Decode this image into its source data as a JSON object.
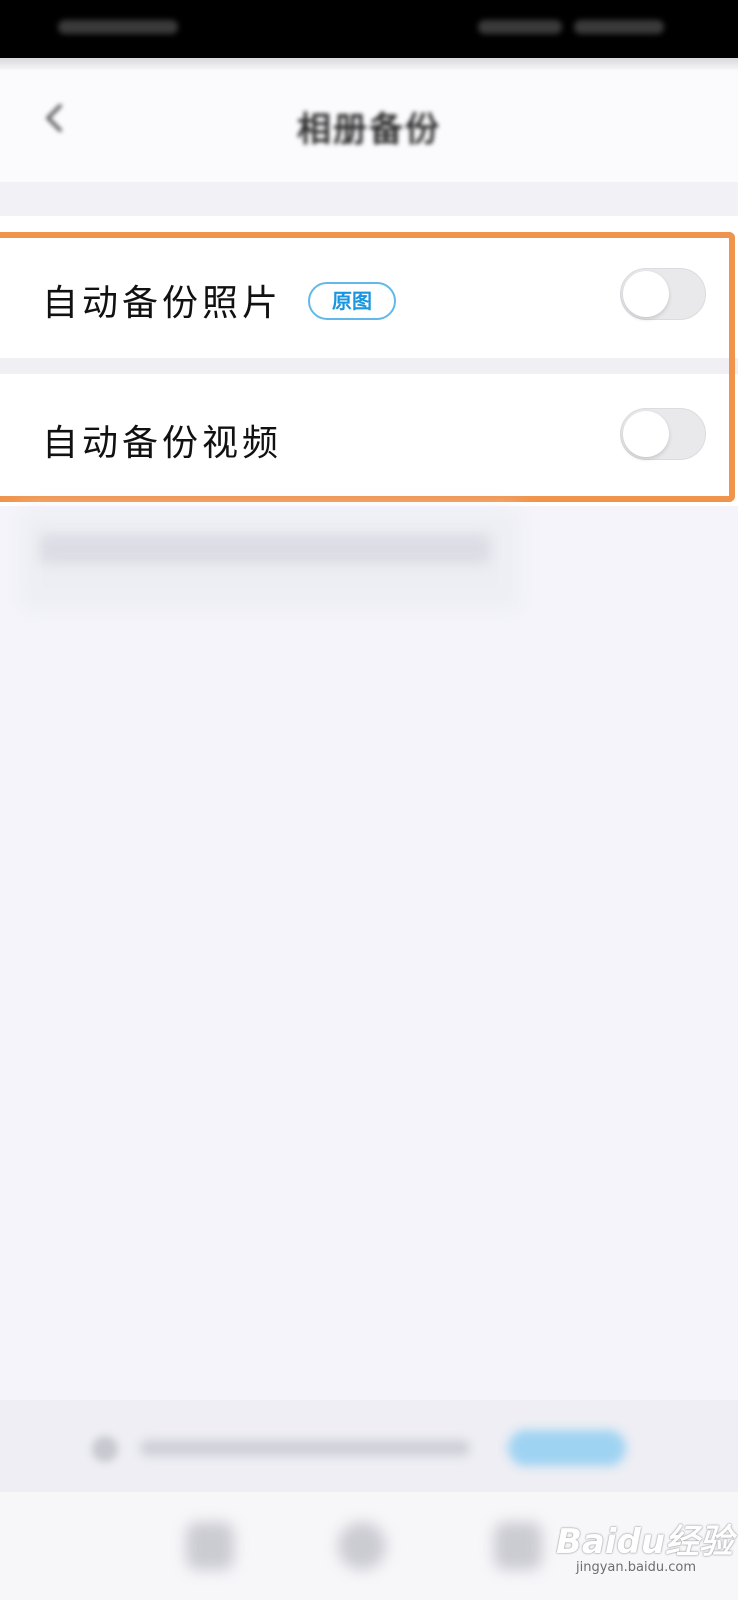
{
  "status_bar": {},
  "header": {
    "title": "相册备份",
    "back_icon": "chevron-left-icon"
  },
  "settings": {
    "auto_backup_photos": {
      "label": "自动备份照片",
      "badge": "原图",
      "enabled": false
    },
    "auto_backup_videos": {
      "label": "自动备份视频",
      "enabled": false
    }
  },
  "colors": {
    "highlight": "#ef944d",
    "badge_text": "#1a96e0",
    "badge_border": "#63b8ea",
    "toggle_off": "#e9e9ec",
    "background": "#f4f4fa"
  },
  "watermark": {
    "logo": "Baidu经验",
    "domain": "jingyan.baidu.com"
  }
}
